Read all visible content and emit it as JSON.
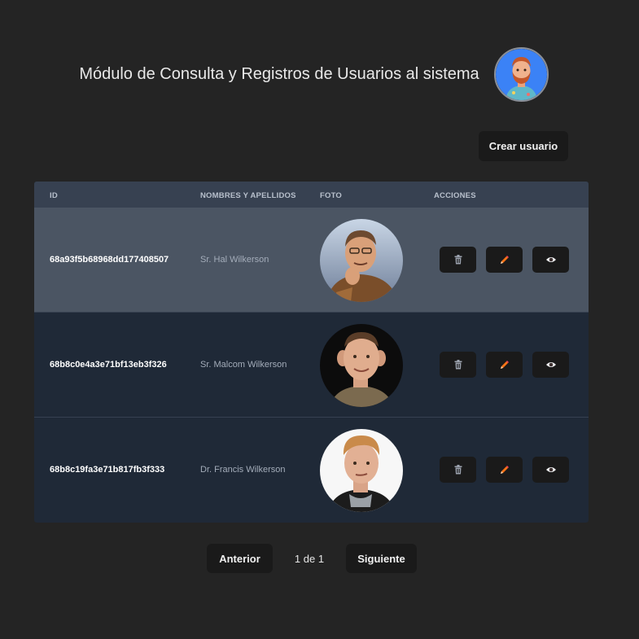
{
  "header": {
    "title": "Módulo de Consulta y Registros de Usuarios al sistema",
    "avatar_icon": "memoji-avatar-icon"
  },
  "toolbar": {
    "create_label": "Crear usuario"
  },
  "table": {
    "columns": [
      "ID",
      "NOMBRES Y APELLIDOS",
      "FOTO",
      "ACCIONES"
    ],
    "rows": [
      {
        "id": "68a93f5b68968dd177408507",
        "name": "Sr. Hal Wilkerson",
        "photo": "portrait-photo"
      },
      {
        "id": "68b8c0e4a3e71bf13eb3f326",
        "name": "Sr. Malcom Wilkerson",
        "photo": "portrait-photo"
      },
      {
        "id": "68b8c19fa3e71b817fb3f333",
        "name": "Dr. Francis Wilkerson",
        "photo": "portrait-photo"
      }
    ],
    "actions": [
      "trash-icon",
      "pencil-icon",
      "eye-icon"
    ]
  },
  "pagination": {
    "prev_label": "Anterior",
    "indicator": "1 de 1",
    "next_label": "Siguiente"
  },
  "colors": {
    "background": "#242424",
    "table_header": "#374151",
    "row_highlight": "#4b5563",
    "row": "#1f2937",
    "button": "#1a1a1a",
    "pencil_accent": "#f97316"
  }
}
